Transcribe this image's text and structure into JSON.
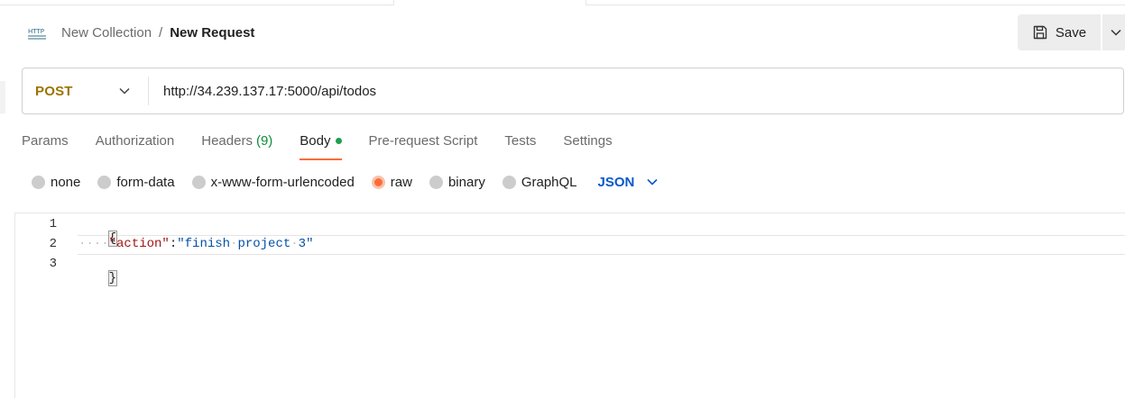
{
  "header": {
    "breadcrumb_parent": "New Collection",
    "breadcrumb_separator": "/",
    "breadcrumb_current": "New Request",
    "http_icon_text": "HTTP",
    "save_label": "Save"
  },
  "request": {
    "method": "POST",
    "url": "http://34.239.137.17:5000/api/todos"
  },
  "tabs": [
    {
      "label": "Params"
    },
    {
      "label": "Authorization"
    },
    {
      "label": "Headers",
      "count": "(9)"
    },
    {
      "label": "Body",
      "active": true
    },
    {
      "label": "Pre-request Script"
    },
    {
      "label": "Tests"
    },
    {
      "label": "Settings"
    }
  ],
  "body_types": [
    {
      "label": "none"
    },
    {
      "label": "form-data"
    },
    {
      "label": "x-www-form-urlencoded"
    },
    {
      "label": "raw",
      "selected": true
    },
    {
      "label": "binary"
    },
    {
      "label": "GraphQL"
    }
  ],
  "body_format": "JSON",
  "editor": {
    "line_numbers": [
      "1",
      "2",
      "3"
    ],
    "open_brace": "{",
    "indent_dots": "····",
    "key": "\"action\"",
    "colon": ":",
    "value_parts": [
      "\"finish",
      "project",
      "3\""
    ],
    "close_brace": "}"
  },
  "colors": {
    "accent": "#ff6c37",
    "method": "#9b7400",
    "format": "#0a58ca",
    "count": "#0a8f3a"
  }
}
